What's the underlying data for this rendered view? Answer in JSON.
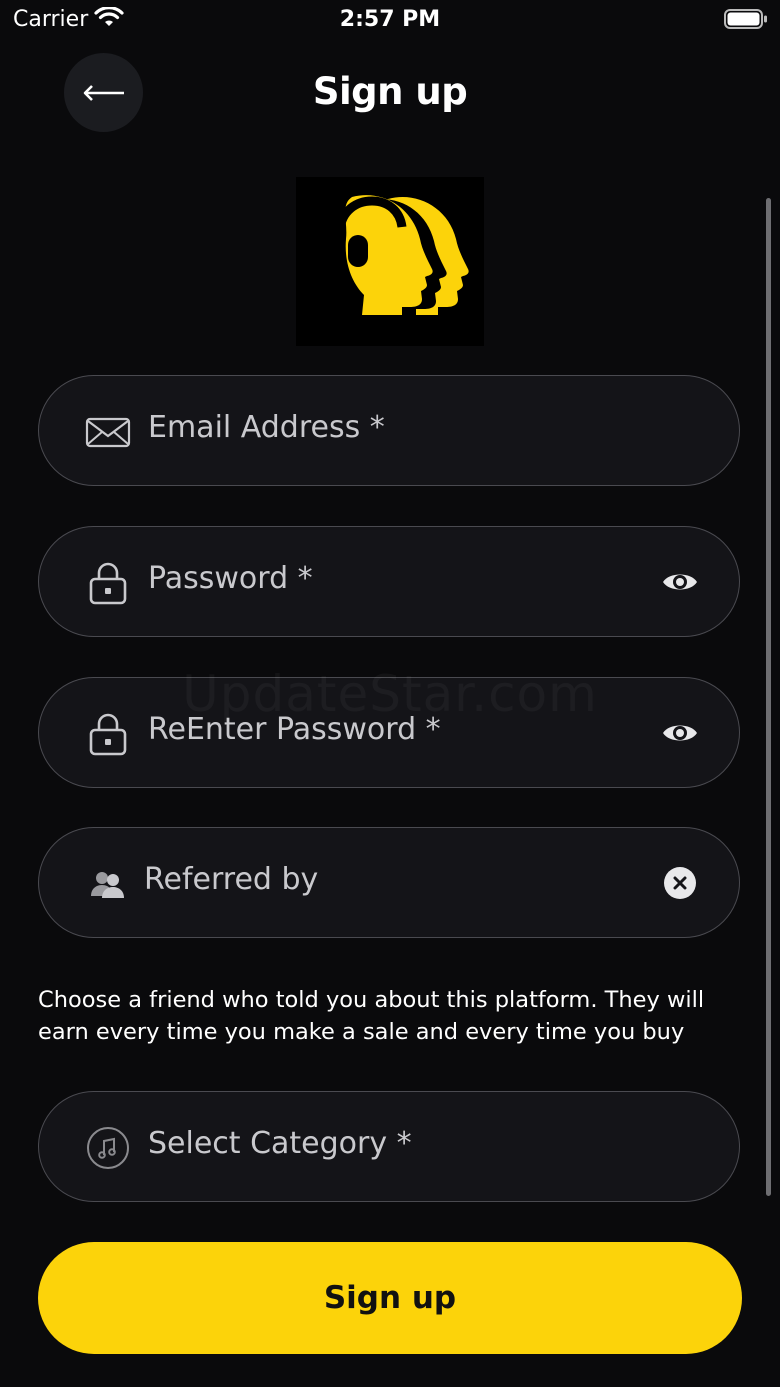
{
  "status_bar": {
    "carrier": "Carrier",
    "time": "2:57 PM"
  },
  "header": {
    "title": "Sign up",
    "back_icon": "arrow-left-icon"
  },
  "logo": {
    "icon": "twin-heads-logo",
    "color": "#fcd30a"
  },
  "form": {
    "email": {
      "placeholder": "Email Address *",
      "icon": "envelope-icon"
    },
    "password": {
      "placeholder": "Password *",
      "icon": "lock-icon",
      "toggle_icon": "eye-icon"
    },
    "reenter_password": {
      "placeholder": "ReEnter Password *",
      "icon": "lock-icon",
      "toggle_icon": "eye-icon"
    },
    "referred_by": {
      "placeholder": "Referred by",
      "icon": "users-icon",
      "clear_icon": "close-circle-icon"
    },
    "referral_help": "Choose a friend who told you about this platform. They will earn every time you make a sale and every time you buy",
    "category": {
      "placeholder": "Select Category *",
      "icon": "music-note-icon"
    }
  },
  "watermark": "UpdateStar.com",
  "submit": {
    "label": "Sign up"
  },
  "colors": {
    "background": "#0a0a0c",
    "accent": "#fcd30a",
    "field_border": "#4a4a50",
    "placeholder": "#c9c9cd"
  }
}
